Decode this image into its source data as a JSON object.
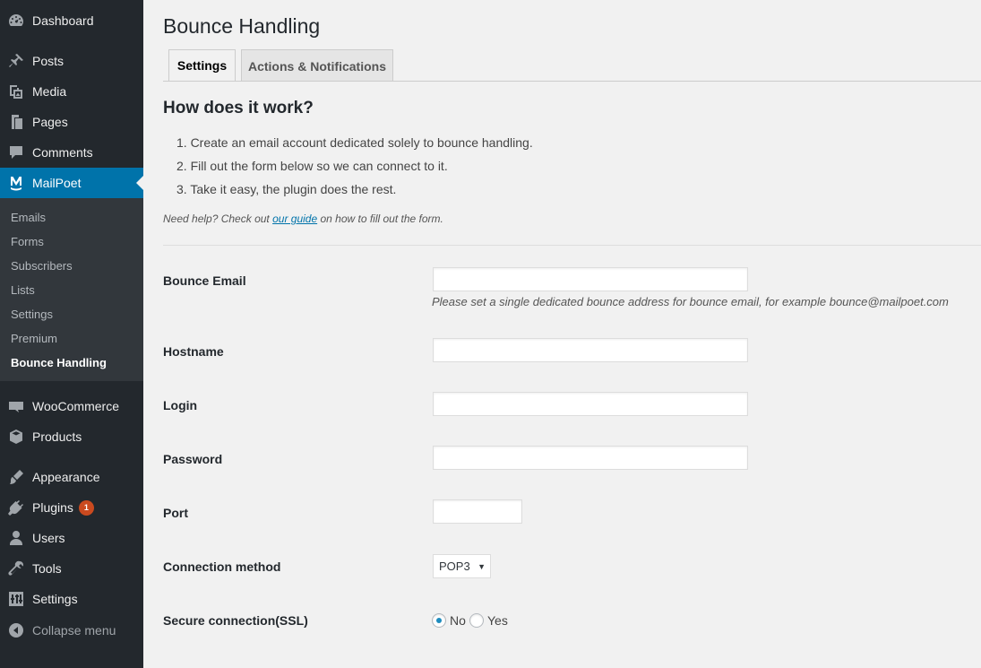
{
  "sidebar": {
    "menu": [
      {
        "label": "Dashboard",
        "icon": "dashboard-icon"
      },
      {
        "label": "Posts",
        "icon": "pin-icon"
      },
      {
        "label": "Media",
        "icon": "media-icon"
      },
      {
        "label": "Pages",
        "icon": "pages-icon"
      },
      {
        "label": "Comments",
        "icon": "comment-icon"
      },
      {
        "label": "MailPoet",
        "icon": "mailpoet-icon"
      },
      {
        "label": "WooCommerce",
        "icon": "woo-icon"
      },
      {
        "label": "Products",
        "icon": "box-icon"
      },
      {
        "label": "Appearance",
        "icon": "brush-icon"
      },
      {
        "label": "Plugins",
        "icon": "plug-icon",
        "badge": "1"
      },
      {
        "label": "Users",
        "icon": "user-icon"
      },
      {
        "label": "Tools",
        "icon": "wrench-icon"
      },
      {
        "label": "Settings",
        "icon": "sliders-icon"
      },
      {
        "label": "Collapse menu",
        "icon": "collapse-icon"
      }
    ],
    "submenu": [
      "Emails",
      "Forms",
      "Subscribers",
      "Lists",
      "Settings",
      "Premium",
      "Bounce Handling"
    ],
    "accent": "#0073aa"
  },
  "page": {
    "title": "Bounce Handling",
    "tabs": [
      "Settings",
      "Actions & Notifications"
    ],
    "heading": "How does it work?",
    "steps": [
      "1. Create an email account dedicated solely to bounce handling.",
      "2. Fill out the form below so we can connect to it.",
      "3. Take it easy, the plugin does the rest."
    ],
    "help_prefix": "Need help? Check out ",
    "help_link": "our guide",
    "help_suffix": " on how to fill out the form."
  },
  "form": {
    "bounce_email_label": "Bounce Email",
    "bounce_email_value": "",
    "bounce_email_desc": "Please set a single dedicated bounce address for bounce email, for example bounce@mailpoet.com",
    "hostname_label": "Hostname",
    "hostname_value": "",
    "login_label": "Login",
    "login_value": "",
    "password_label": "Password",
    "password_value": "",
    "port_label": "Port",
    "port_value": "",
    "connection_label": "Connection method",
    "connection_value": "POP3",
    "ssl_label": "Secure connection(SSL)",
    "ssl_no": "No",
    "ssl_yes": "Yes",
    "ssl_selected": "No"
  }
}
